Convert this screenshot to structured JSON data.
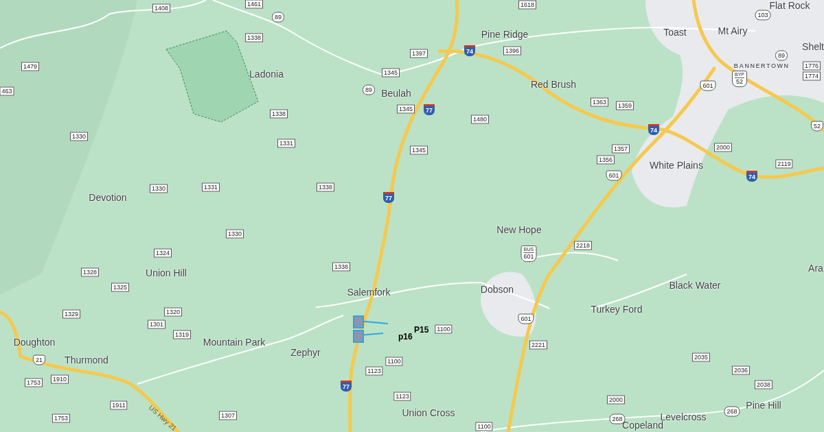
{
  "places": [
    "Toast",
    "Mt Airy",
    "Flat Rock",
    "Shelt",
    "BANNERTOWN",
    "Pine Ridge",
    "Ladonia",
    "Beulah",
    "Red Brush",
    "White Plains",
    "Devotion",
    "New Hope",
    "Union Hill",
    "Salemfork",
    "Dobson",
    "Turkey Ford",
    "Black Water",
    "Ara",
    "Doughton",
    "Thurmond",
    "Mountain Park",
    "Zephyr",
    "Union Cross",
    "Levelcross",
    "Pine Hill",
    "Copeland"
  ],
  "road_labels": [
    "US Hwy 21"
  ],
  "shields": [
    {
      "label": "1461",
      "kind": "county"
    },
    {
      "label": "1408",
      "kind": "county"
    },
    {
      "label": "1338",
      "kind": "county"
    },
    {
      "label": "1479",
      "kind": "county"
    },
    {
      "label": "463",
      "kind": "county"
    },
    {
      "label": "1330",
      "kind": "county"
    },
    {
      "label": "1330",
      "kind": "county"
    },
    {
      "label": "1331",
      "kind": "county"
    },
    {
      "label": "1331",
      "kind": "county"
    },
    {
      "label": "1338",
      "kind": "county"
    },
    {
      "label": "1338",
      "kind": "county"
    },
    {
      "label": "1330",
      "kind": "county"
    },
    {
      "label": "1324",
      "kind": "county"
    },
    {
      "label": "1328",
      "kind": "county"
    },
    {
      "label": "1325",
      "kind": "county"
    },
    {
      "label": "1320",
      "kind": "county"
    },
    {
      "label": "1301",
      "kind": "county"
    },
    {
      "label": "1319",
      "kind": "county"
    },
    {
      "label": "1329",
      "kind": "county"
    },
    {
      "label": "1338",
      "kind": "county"
    },
    {
      "label": "1397",
      "kind": "county"
    },
    {
      "label": "1345",
      "kind": "county"
    },
    {
      "label": "1345",
      "kind": "county"
    },
    {
      "label": "1345",
      "kind": "county"
    },
    {
      "label": "1396",
      "kind": "county"
    },
    {
      "label": "1618",
      "kind": "county"
    },
    {
      "label": "1480",
      "kind": "county"
    },
    {
      "label": "1363",
      "kind": "county"
    },
    {
      "label": "1359",
      "kind": "county"
    },
    {
      "label": "1357",
      "kind": "county"
    },
    {
      "label": "1356",
      "kind": "county"
    },
    {
      "label": "2000",
      "kind": "county"
    },
    {
      "label": "2119",
      "kind": "county"
    },
    {
      "label": "1776",
      "kind": "county"
    },
    {
      "label": "1774",
      "kind": "county"
    },
    {
      "label": "1100",
      "kind": "county"
    },
    {
      "label": "1100",
      "kind": "county"
    },
    {
      "label": "1123",
      "kind": "county"
    },
    {
      "label": "1123",
      "kind": "county"
    },
    {
      "label": "2218",
      "kind": "county"
    },
    {
      "label": "2221",
      "kind": "county"
    },
    {
      "label": "2035",
      "kind": "county"
    },
    {
      "label": "2036",
      "kind": "county"
    },
    {
      "label": "2038",
      "kind": "county"
    },
    {
      "label": "2000",
      "kind": "county"
    },
    {
      "label": "1753",
      "kind": "county"
    },
    {
      "label": "1910",
      "kind": "county"
    },
    {
      "label": "1911",
      "kind": "county"
    },
    {
      "label": "1753",
      "kind": "county"
    },
    {
      "label": "1307",
      "kind": "county"
    },
    {
      "label": "1100",
      "kind": "county"
    },
    {
      "label": "89",
      "kind": "state"
    },
    {
      "label": "89",
      "kind": "state"
    },
    {
      "label": "103",
      "kind": "state"
    },
    {
      "label": "89",
      "kind": "state"
    },
    {
      "label": "268",
      "kind": "state"
    },
    {
      "label": "268",
      "kind": "state"
    },
    {
      "label": "74",
      "kind": "interstate"
    },
    {
      "label": "77",
      "kind": "interstate"
    },
    {
      "label": "77",
      "kind": "interstate"
    },
    {
      "label": "74",
      "kind": "interstate"
    },
    {
      "label": "74",
      "kind": "interstate"
    },
    {
      "label": "77",
      "kind": "interstate"
    },
    {
      "label": "601",
      "kind": "us"
    },
    {
      "label": "52",
      "kind": "us",
      "banner": "BYP"
    },
    {
      "label": "52",
      "kind": "us"
    },
    {
      "label": "601",
      "kind": "us"
    },
    {
      "label": "601",
      "kind": "us",
      "banner": "BUS"
    },
    {
      "label": "601",
      "kind": "us"
    },
    {
      "label": "21",
      "kind": "us"
    }
  ],
  "parcels": [
    {
      "label": "P15"
    },
    {
      "label": "p16"
    }
  ]
}
